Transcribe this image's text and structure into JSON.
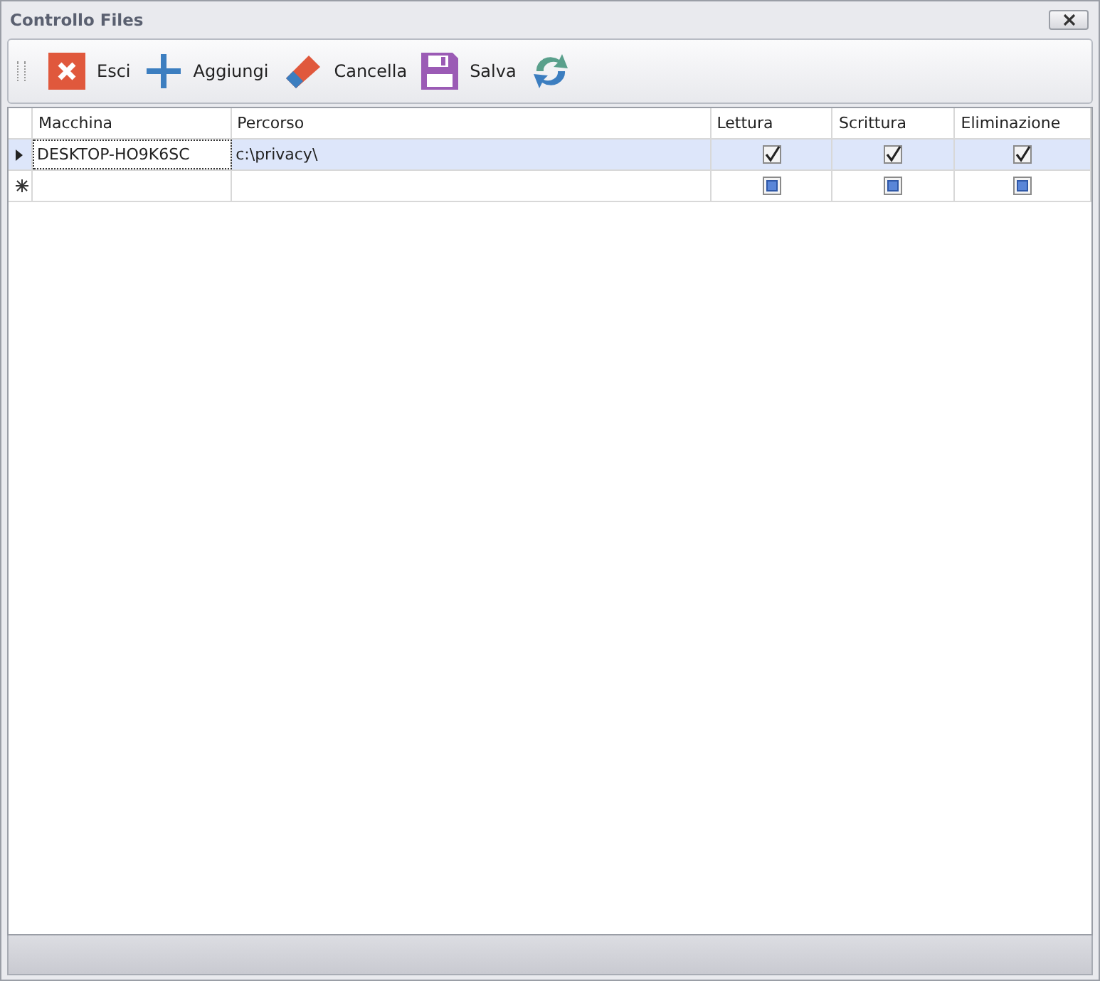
{
  "window": {
    "title": "Controllo Files"
  },
  "toolbar": [
    {
      "kind": "exit",
      "label": "Esci"
    },
    {
      "kind": "add",
      "label": "Aggiungi"
    },
    {
      "kind": "erase",
      "label": "Cancella"
    },
    {
      "kind": "save",
      "label": "Salva"
    },
    {
      "kind": "refresh"
    }
  ],
  "table": {
    "columns": [
      "Macchina",
      "Percorso",
      "Lettura",
      "Scrittura",
      "Eliminazione"
    ],
    "rows": [
      {
        "kind": "data",
        "selected": true,
        "cells": [
          "DESKTOP-HO9K6SC",
          "c:\\privacy\\"
        ],
        "checks": [
          {
            "checked": true,
            "indeterminate": false
          },
          {
            "checked": true,
            "indeterminate": false
          },
          {
            "checked": true,
            "indeterminate": false
          }
        ]
      },
      {
        "kind": "new",
        "selected": false,
        "cells": [],
        "checks": [
          {
            "checked": false,
            "indeterminate": true
          },
          {
            "checked": false,
            "indeterminate": true
          },
          {
            "checked": false,
            "indeterminate": true
          }
        ]
      }
    ]
  }
}
